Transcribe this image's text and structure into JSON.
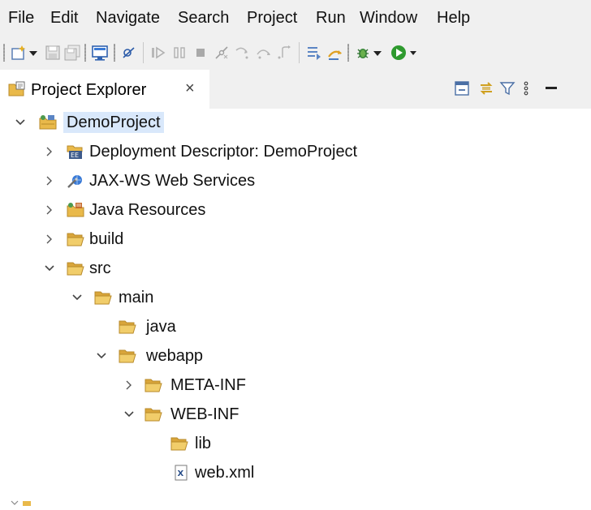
{
  "menu": {
    "items": [
      "File",
      "Edit",
      "Navigate",
      "Search",
      "Project",
      "Run",
      "Window",
      "Help"
    ]
  },
  "toolbar": {
    "icons": [
      "new-wizard-icon",
      "dropdown-arrow-icon",
      "save-icon",
      "save-all-icon",
      "console-icon",
      "skip-breakpoints-icon",
      "resume-icon",
      "suspend-icon",
      "terminate-icon",
      "disconnect-icon",
      "step-into-icon",
      "step-over-icon",
      "step-return-icon",
      "drop-to-frame-icon",
      "use-step-filters-icon",
      "debug-icon",
      "run-icon"
    ]
  },
  "view": {
    "tab_label": "Project Explorer",
    "close_glyph": "×",
    "tools": [
      "collapse-all-icon",
      "link-with-editor-icon",
      "filter-icon",
      "view-menu-icon",
      "minimize-icon"
    ]
  },
  "tree": {
    "items": [
      {
        "label": "DemoProject",
        "icon": "project-icon",
        "expanded": true,
        "selected": true
      },
      {
        "label": "Deployment Descriptor: DemoProject",
        "icon": "deployment-descriptor-icon",
        "expanded": false
      },
      {
        "label": "JAX-WS Web Services",
        "icon": "web-services-icon",
        "expanded": false
      },
      {
        "label": "Java Resources",
        "icon": "java-resources-icon",
        "expanded": false
      },
      {
        "label": "build",
        "icon": "folder-icon",
        "expanded": false
      },
      {
        "label": "src",
        "icon": "folder-icon",
        "expanded": true
      },
      {
        "label": "main",
        "icon": "folder-icon",
        "expanded": true
      },
      {
        "label": "java",
        "icon": "folder-icon",
        "expanded": null
      },
      {
        "label": "webapp",
        "icon": "folder-icon",
        "expanded": true
      },
      {
        "label": "META-INF",
        "icon": "folder-icon",
        "expanded": false
      },
      {
        "label": "WEB-INF",
        "icon": "folder-icon",
        "expanded": true
      },
      {
        "label": "lib",
        "icon": "folder-icon",
        "expanded": null
      },
      {
        "label": "web.xml",
        "icon": "xml-file-icon",
        "expanded": null
      }
    ]
  },
  "colors": {
    "chrome_bg": "#f0f0f0",
    "folder": "#e9b94a",
    "selection": "#d9e8fb"
  }
}
